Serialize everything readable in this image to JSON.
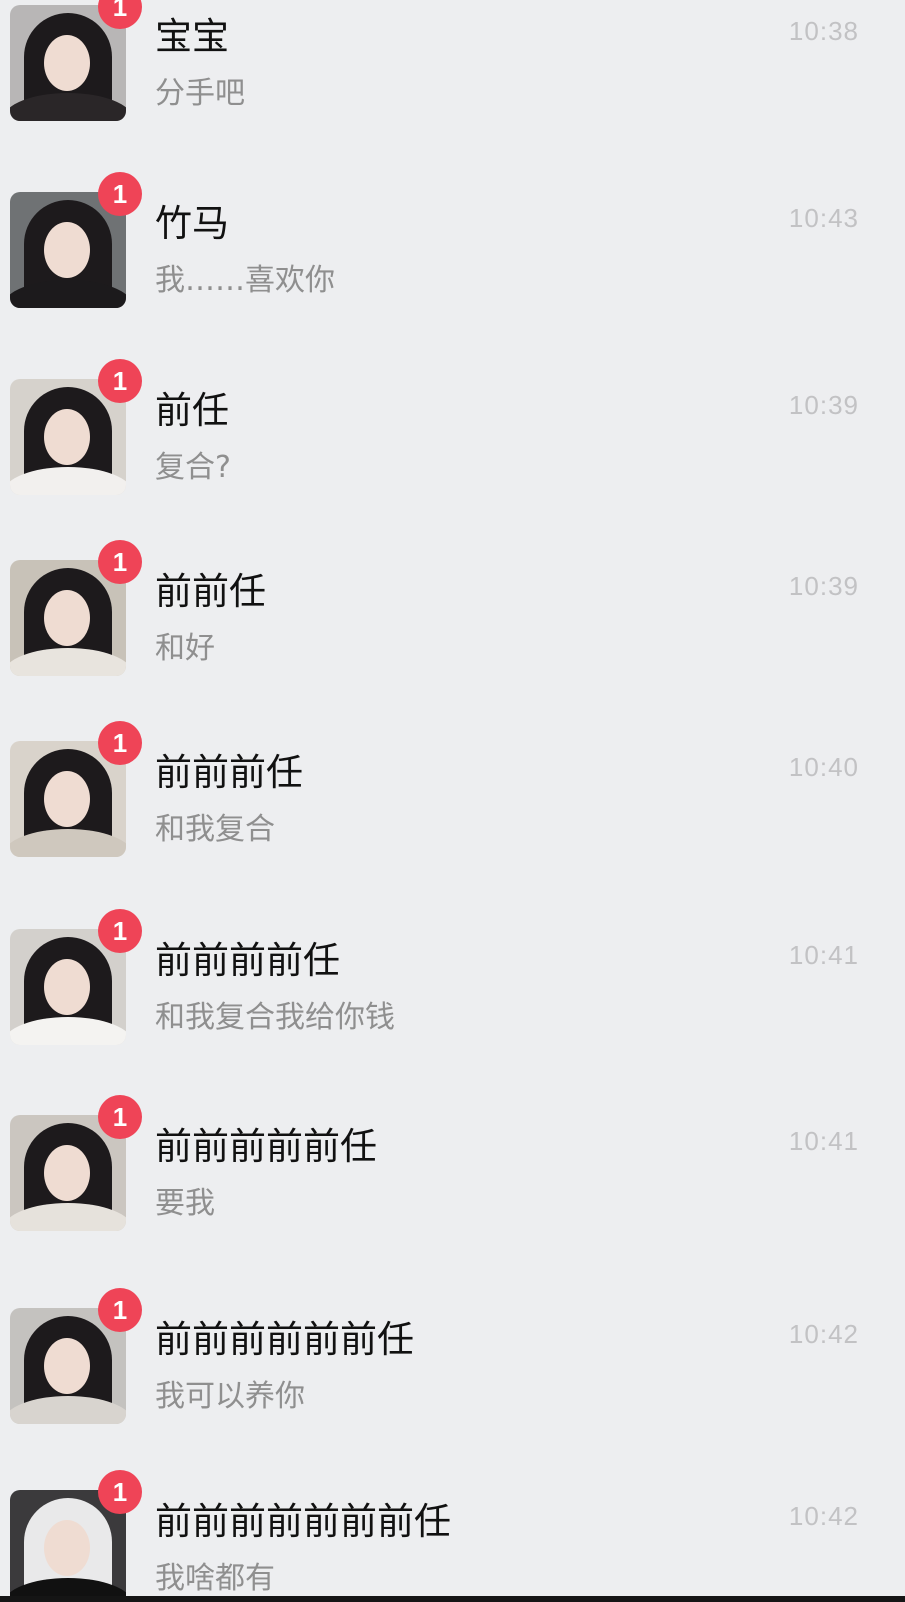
{
  "chats": [
    {
      "name": "宝宝",
      "preview": "分手吧",
      "time": "10:38",
      "unread": "1"
    },
    {
      "name": "竹马",
      "preview": "我……喜欢你",
      "time": "10:43",
      "unread": "1"
    },
    {
      "name": "前任",
      "preview": "复合?",
      "time": "10:39",
      "unread": "1"
    },
    {
      "name": "前前任",
      "preview": "和好",
      "time": "10:39",
      "unread": "1"
    },
    {
      "name": "前前前任",
      "preview": "和我复合",
      "time": "10:40",
      "unread": "1"
    },
    {
      "name": "前前前前任",
      "preview": "和我复合我给你钱",
      "time": "10:41",
      "unread": "1"
    },
    {
      "name": "前前前前前任",
      "preview": "要我",
      "time": "10:41",
      "unread": "1"
    },
    {
      "name": "前前前前前前任",
      "preview": "我可以养你",
      "time": "10:42",
      "unread": "1"
    },
    {
      "name": "前前前前前前前任",
      "preview": "我啥都有",
      "time": "10:42",
      "unread": "1"
    }
  ],
  "colors": {
    "background": "#edeef0",
    "badge": "#ef4457",
    "name": "#111111",
    "preview": "#8f8f8f",
    "time": "#c2c2c4"
  }
}
